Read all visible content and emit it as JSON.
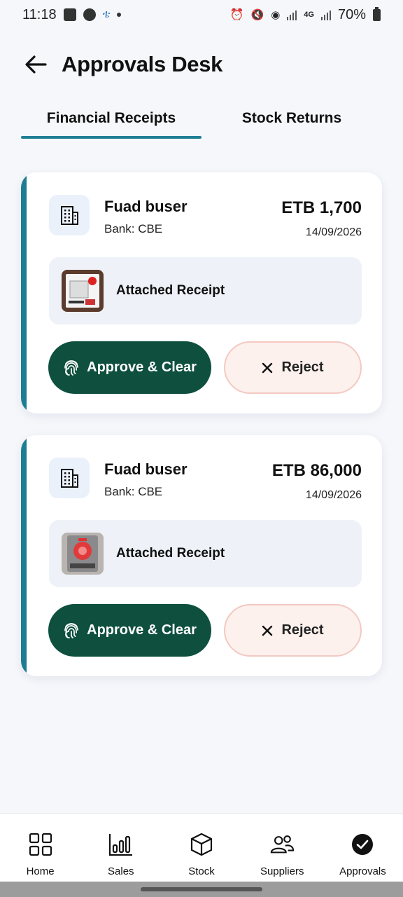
{
  "status_bar": {
    "time": "11:18",
    "battery": "70%",
    "network": "4G"
  },
  "header": {
    "title": "Approvals Desk"
  },
  "tabs": [
    {
      "label": "Financial Receipts",
      "active": true
    },
    {
      "label": "Stock Returns",
      "active": false
    }
  ],
  "cards": [
    {
      "name": "Fuad buser",
      "bank": "Bank: CBE",
      "amount": "ETB 1,700",
      "date": "14/09/2026",
      "receipt_label": "Attached Receipt",
      "approve_label": "Approve & Clear",
      "reject_label": "Reject"
    },
    {
      "name": "Fuad buser",
      "bank": "Bank: CBE",
      "amount": "ETB 86,000",
      "date": "14/09/2026",
      "receipt_label": "Attached Receipt",
      "approve_label": "Approve & Clear",
      "reject_label": "Reject"
    }
  ],
  "bottom_nav": [
    {
      "label": "Home",
      "icon": "grid-icon"
    },
    {
      "label": "Sales",
      "icon": "bar-chart-icon"
    },
    {
      "label": "Stock",
      "icon": "box-icon"
    },
    {
      "label": "Suppliers",
      "icon": "users-icon"
    },
    {
      "label": "Approvals",
      "icon": "check-circle-icon",
      "active": true
    }
  ],
  "colors": {
    "accent": "#1f7f94",
    "approve": "#0e4f3e",
    "reject_bg": "#fdf1ee",
    "reject_border": "#f3c9c2",
    "background": "#f5f7fb"
  }
}
